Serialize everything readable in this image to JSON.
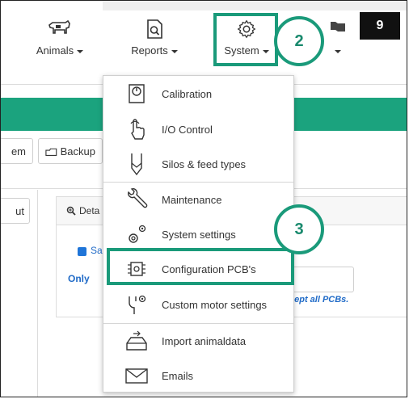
{
  "step_number": "9",
  "nav": {
    "animals": "Animals",
    "reports": "Reports",
    "system": "System"
  },
  "callouts": {
    "c2": "2",
    "c3": "3"
  },
  "toolbar": {
    "left_fragment": "em",
    "backup": "Backup",
    "left2_fragment": "ut"
  },
  "panel": {
    "title": "Deta",
    "checkbox_label": "Sa",
    "only_text": "Only",
    "except_text": "cept all PCBs."
  },
  "menu": {
    "items": [
      {
        "label": "Calibration",
        "icon": "calibration-icon"
      },
      {
        "label": "I/O Control",
        "icon": "hand-pointer-icon"
      },
      {
        "label": "Silos & feed types",
        "icon": "silo-icon"
      },
      {
        "label": "Maintenance",
        "icon": "wrench-icon"
      },
      {
        "label": "System settings",
        "icon": "gears-icon"
      },
      {
        "label": "Configuration PCB's",
        "icon": "chip-gear-icon"
      },
      {
        "label": "Custom motor settings",
        "icon": "motor-gear-icon"
      },
      {
        "label": "Import animaldata",
        "icon": "import-tray-icon"
      },
      {
        "label": "Emails",
        "icon": "envelope-icon"
      }
    ]
  },
  "colors": {
    "brand_green": "#1ba37e",
    "highlight": "#1a9a7a",
    "link_blue": "#1f6ac7"
  }
}
